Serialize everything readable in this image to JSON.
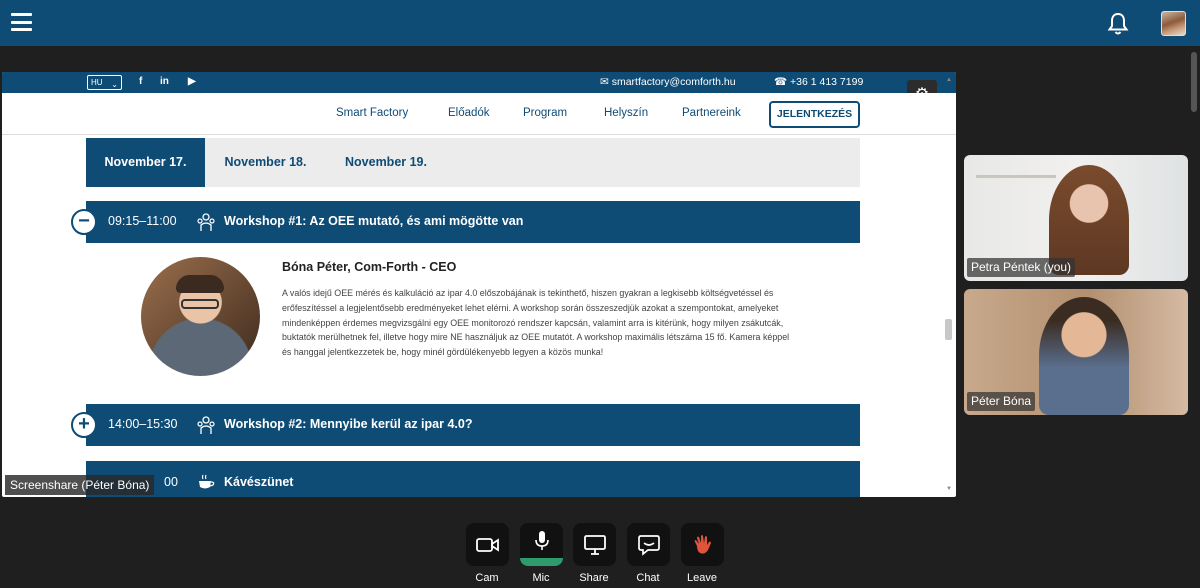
{
  "topbar": {
    "menu_icon": "hamburger-icon",
    "bell_icon": "bell-icon",
    "avatar_icon": "user-avatar"
  },
  "site": {
    "lang": "HU",
    "email": "smartfactory@comforth.hu",
    "phone": "+36 1 413 7199",
    "nav": [
      "Smart Factory",
      "Előadók",
      "Program",
      "Helyszín",
      "Partnereink"
    ],
    "cta": "JELENTKEZÉS",
    "days": [
      "November 17.",
      "November 18.",
      "November 19."
    ],
    "sessions": [
      {
        "time": "09:15–11:00",
        "title": "Workshop #1: Az OEE mutató, és ami mögötte van",
        "expanded": true
      },
      {
        "time": "14:00–15:30",
        "title": "Workshop #2: Mennyibe kerül az ipar 4.0?",
        "expanded": false
      },
      {
        "time": "00",
        "title": "Kávészünet",
        "expanded": false
      }
    ],
    "speaker": {
      "name": "Bóna Péter, Com-Forth - CEO",
      "desc": "A valós idejű OEE mérés és kalkuláció az ipar 4.0 előszobájának is tekinthető, hiszen gyakran a legkisebb költségvetéssel és erőfeszítéssel a legjelentősebb eredményeket lehet elérni. A workshop során összeszedjük azokat a szempontokat, amelyeket mindenképpen érdemes megvizsgálni egy OEE monitorozó rendszer kapcsán, valamint arra is kitérünk, hogy milyen zsákutcák, buktatók merülhetnek fel, illetve hogy mire NE használjuk az OEE mutatót. A workshop maximális létszáma 15 fő. Kamera képpel és hanggal jelentkezzetek be, hogy minél gördülékenyebb legyen a közös munka!"
    }
  },
  "share_label": "Screenshare (Péter Bóna)",
  "participants": [
    "Petra Péntek (you)",
    "Péter Bóna"
  ],
  "controls": [
    "Cam",
    "Mic",
    "Share",
    "Chat",
    "Leave"
  ],
  "colors": {
    "brand": "#0e4b75",
    "mic_active": "#2f9a6e",
    "leave": "#e0543c"
  }
}
